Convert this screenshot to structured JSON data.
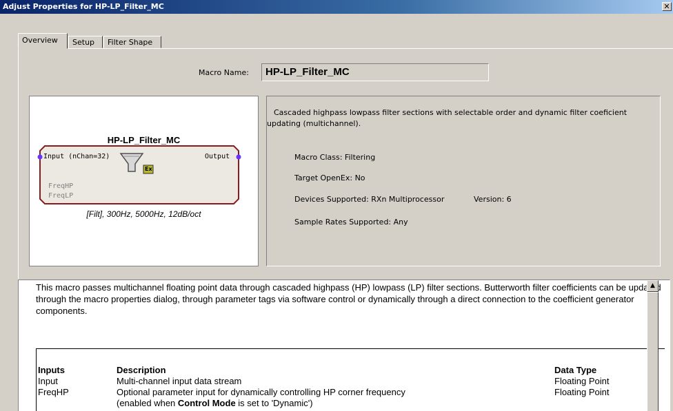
{
  "window": {
    "title": "Adjust Properties for HP-LP_Filter_MC",
    "close_glyph": "✕"
  },
  "tabs": [
    {
      "label": "Overview",
      "active": true
    },
    {
      "label": "Setup",
      "active": false
    },
    {
      "label": "Filter Shape",
      "active": false
    }
  ],
  "macro": {
    "name_label": "Macro Name:",
    "name_value": "HP-LP_Filter_MC"
  },
  "block": {
    "title": "HP-LP_Filter_MC",
    "input_port": "Input (nChan=32)",
    "output_port": "Output",
    "param_ports": [
      "FreqHP",
      "FreqLP"
    ],
    "badge": "Ex",
    "caption": "[Filt], 300Hz,  5000Hz,  12dB/oct",
    "icon": "funnel-filter-icon",
    "colors": {
      "border": "#8b1a1a",
      "fill": "#ece9e2",
      "port": "#6633ff"
    }
  },
  "info": {
    "summary": "Cascaded highpass lowpass filter sections with selectable order and dynamic filter coeficient updating (multichannel).",
    "macro_class": "Macro Class:  Filtering",
    "target_openex": "Target OpenEx:  No",
    "devices_supported": "Devices Supported:  RXn Multiprocessor",
    "version": "Version:  6",
    "sample_rates": "Sample Rates Supported:  Any"
  },
  "description": {
    "paragraph": "This macro passes multichannel floating point data through cascaded highpass (HP) lowpass (LP) filter sections. Butterworth filter coefficients can be updated through the macro properties dialog, through parameter tags via software control or dynamically through a direct connection to the coefficient generator components.",
    "table": {
      "headers": [
        "Inputs",
        "Description",
        "Data Type"
      ],
      "rows": [
        {
          "name": "Input",
          "desc": "Multi-channel input data stream",
          "type": "Floating Point"
        },
        {
          "name": "FreqHP",
          "desc": "Optional parameter input for dynamically controlling HP corner frequency",
          "type": "Floating Point"
        }
      ],
      "note_pre": "(enabled when ",
      "note_bold": "Control Mode",
      "note_post": " is set to 'Dynamic')"
    }
  },
  "scrollbar": {
    "up_glyph": "▲",
    "position": 0.0
  }
}
